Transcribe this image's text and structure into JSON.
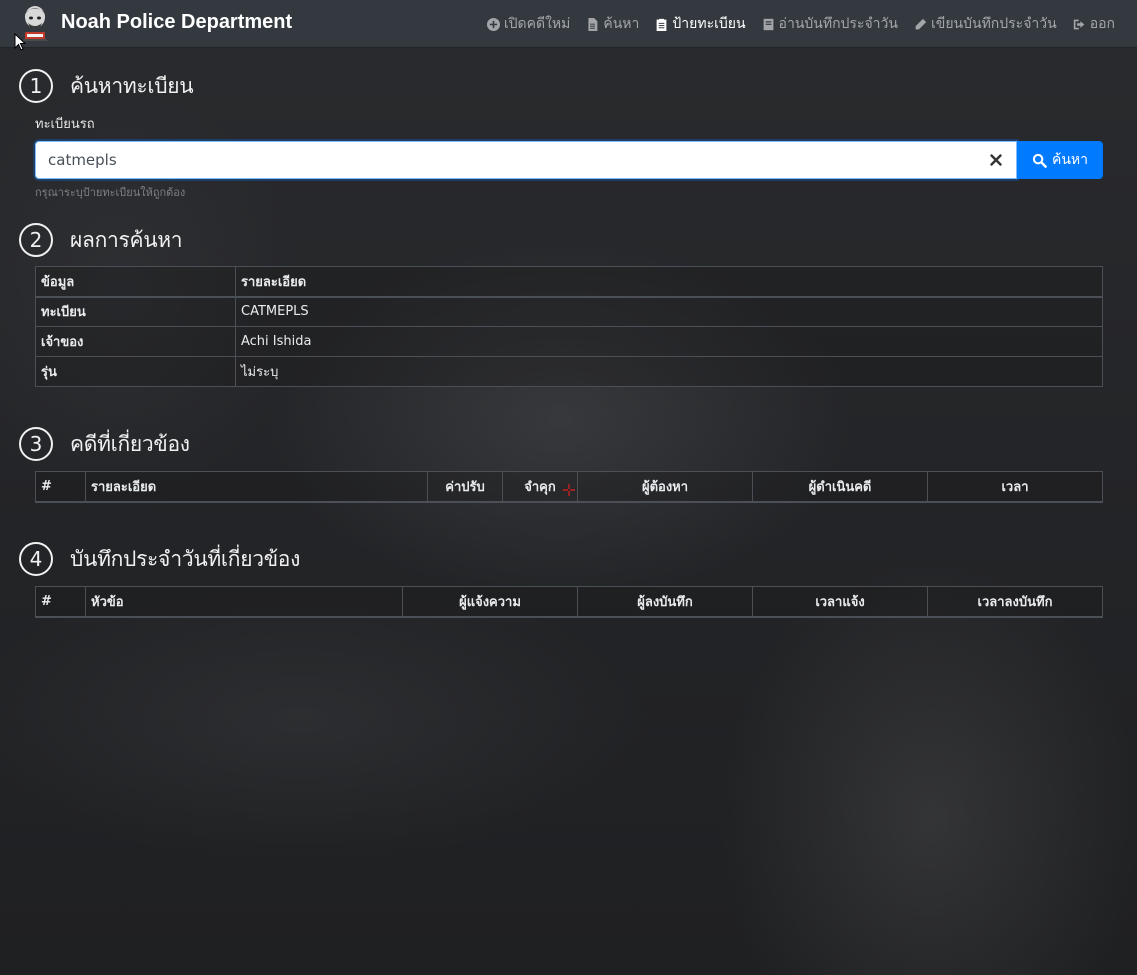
{
  "navbar": {
    "brand": "Noah Police Department",
    "links": [
      {
        "label": "เปิดคดีใหม่",
        "icon": "plus-circle-icon",
        "active": false
      },
      {
        "label": "ค้นหา",
        "icon": "file-icon",
        "active": false
      },
      {
        "label": "ป้ายทะเบียน",
        "icon": "clipboard-icon",
        "active": true
      },
      {
        "label": "อ่านบันทึกประจำวัน",
        "icon": "book-icon",
        "active": false
      },
      {
        "label": "เขียนบันทึกประจำวัน",
        "icon": "pencil-icon",
        "active": false
      },
      {
        "label": "ออก",
        "icon": "sign-out-icon",
        "active": false
      }
    ]
  },
  "sections": {
    "s1": {
      "number": "1",
      "title": "ค้นหาทะเบียน"
    },
    "s2": {
      "number": "2",
      "title": "ผลการค้นหา"
    },
    "s3": {
      "number": "3",
      "title": "คดีที่เกี่ยวข้อง"
    },
    "s4": {
      "number": "4",
      "title": "บันทึกประจำวันที่เกี่ยวข้อง"
    }
  },
  "search": {
    "label": "ทะเบียนรถ",
    "value": "catmepls",
    "button_label": "ค้นหา",
    "help": "กรุณาระบุป้ายทะเบียนให้ถูกต้อง"
  },
  "result_table": {
    "headers": [
      "ข้อมูล",
      "รายละเอียด"
    ],
    "rows": [
      {
        "key": "ทะเบียน",
        "value": "CATMEPLS"
      },
      {
        "key": "เจ้าของ",
        "value": "Achi Ishida"
      },
      {
        "key": "รุ่น",
        "value": "ไม่ระบุ"
      }
    ]
  },
  "cases_table": {
    "headers": [
      "#",
      "รายละเอียด",
      "ค่าปรับ",
      "จำคุก",
      "ผู้ต้องหา",
      "ผู้ดำเนินคดี",
      "เวลา"
    ]
  },
  "reports_table": {
    "headers": [
      "#",
      "หัวข้อ",
      "ผู้แจ้งความ",
      "ผู้ลงบันทึก",
      "เวลาแจ้ง",
      "เวลาลงบันทึก"
    ]
  },
  "colors": {
    "primary": "#007bff",
    "navbar": "#343a40"
  }
}
